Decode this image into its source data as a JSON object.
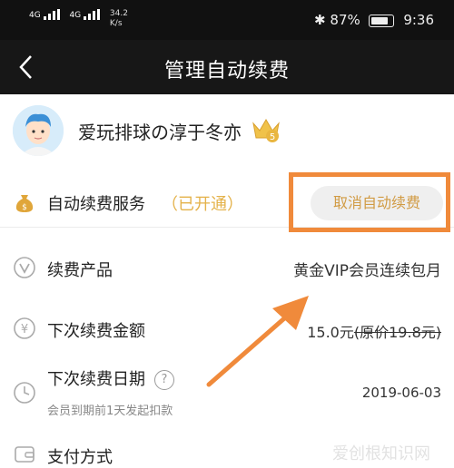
{
  "status_bar": {
    "signal1": "4G",
    "signal2": "4G",
    "speed_value": "34.2",
    "speed_unit": "K/s",
    "battery": "87%",
    "time": "9:36"
  },
  "navbar": {
    "title": "管理自动续费"
  },
  "user": {
    "name": "爱玩排球の淳于冬亦",
    "vip_level": "5"
  },
  "auto_renew": {
    "label": "自动续费服务",
    "status": "（已开通）",
    "cancel_label": "取消自动续费"
  },
  "rows": {
    "product": {
      "label": "续费产品",
      "value": "黄金VIP会员连续包月"
    },
    "amount": {
      "label": "下次续费金额",
      "price": "15.0元",
      "original": "(原价19.8元)"
    },
    "date": {
      "label": "下次续费日期",
      "help": "?",
      "note": "会员到期前1天发起扣款",
      "value": "2019-06-03"
    },
    "payment": {
      "label": "支付方式"
    }
  },
  "watermark": "爱创根知识网",
  "colors": {
    "accent_gold": "#e4b24a",
    "highlight_orange": "#f08a3b",
    "nav_bg": "#171717"
  }
}
